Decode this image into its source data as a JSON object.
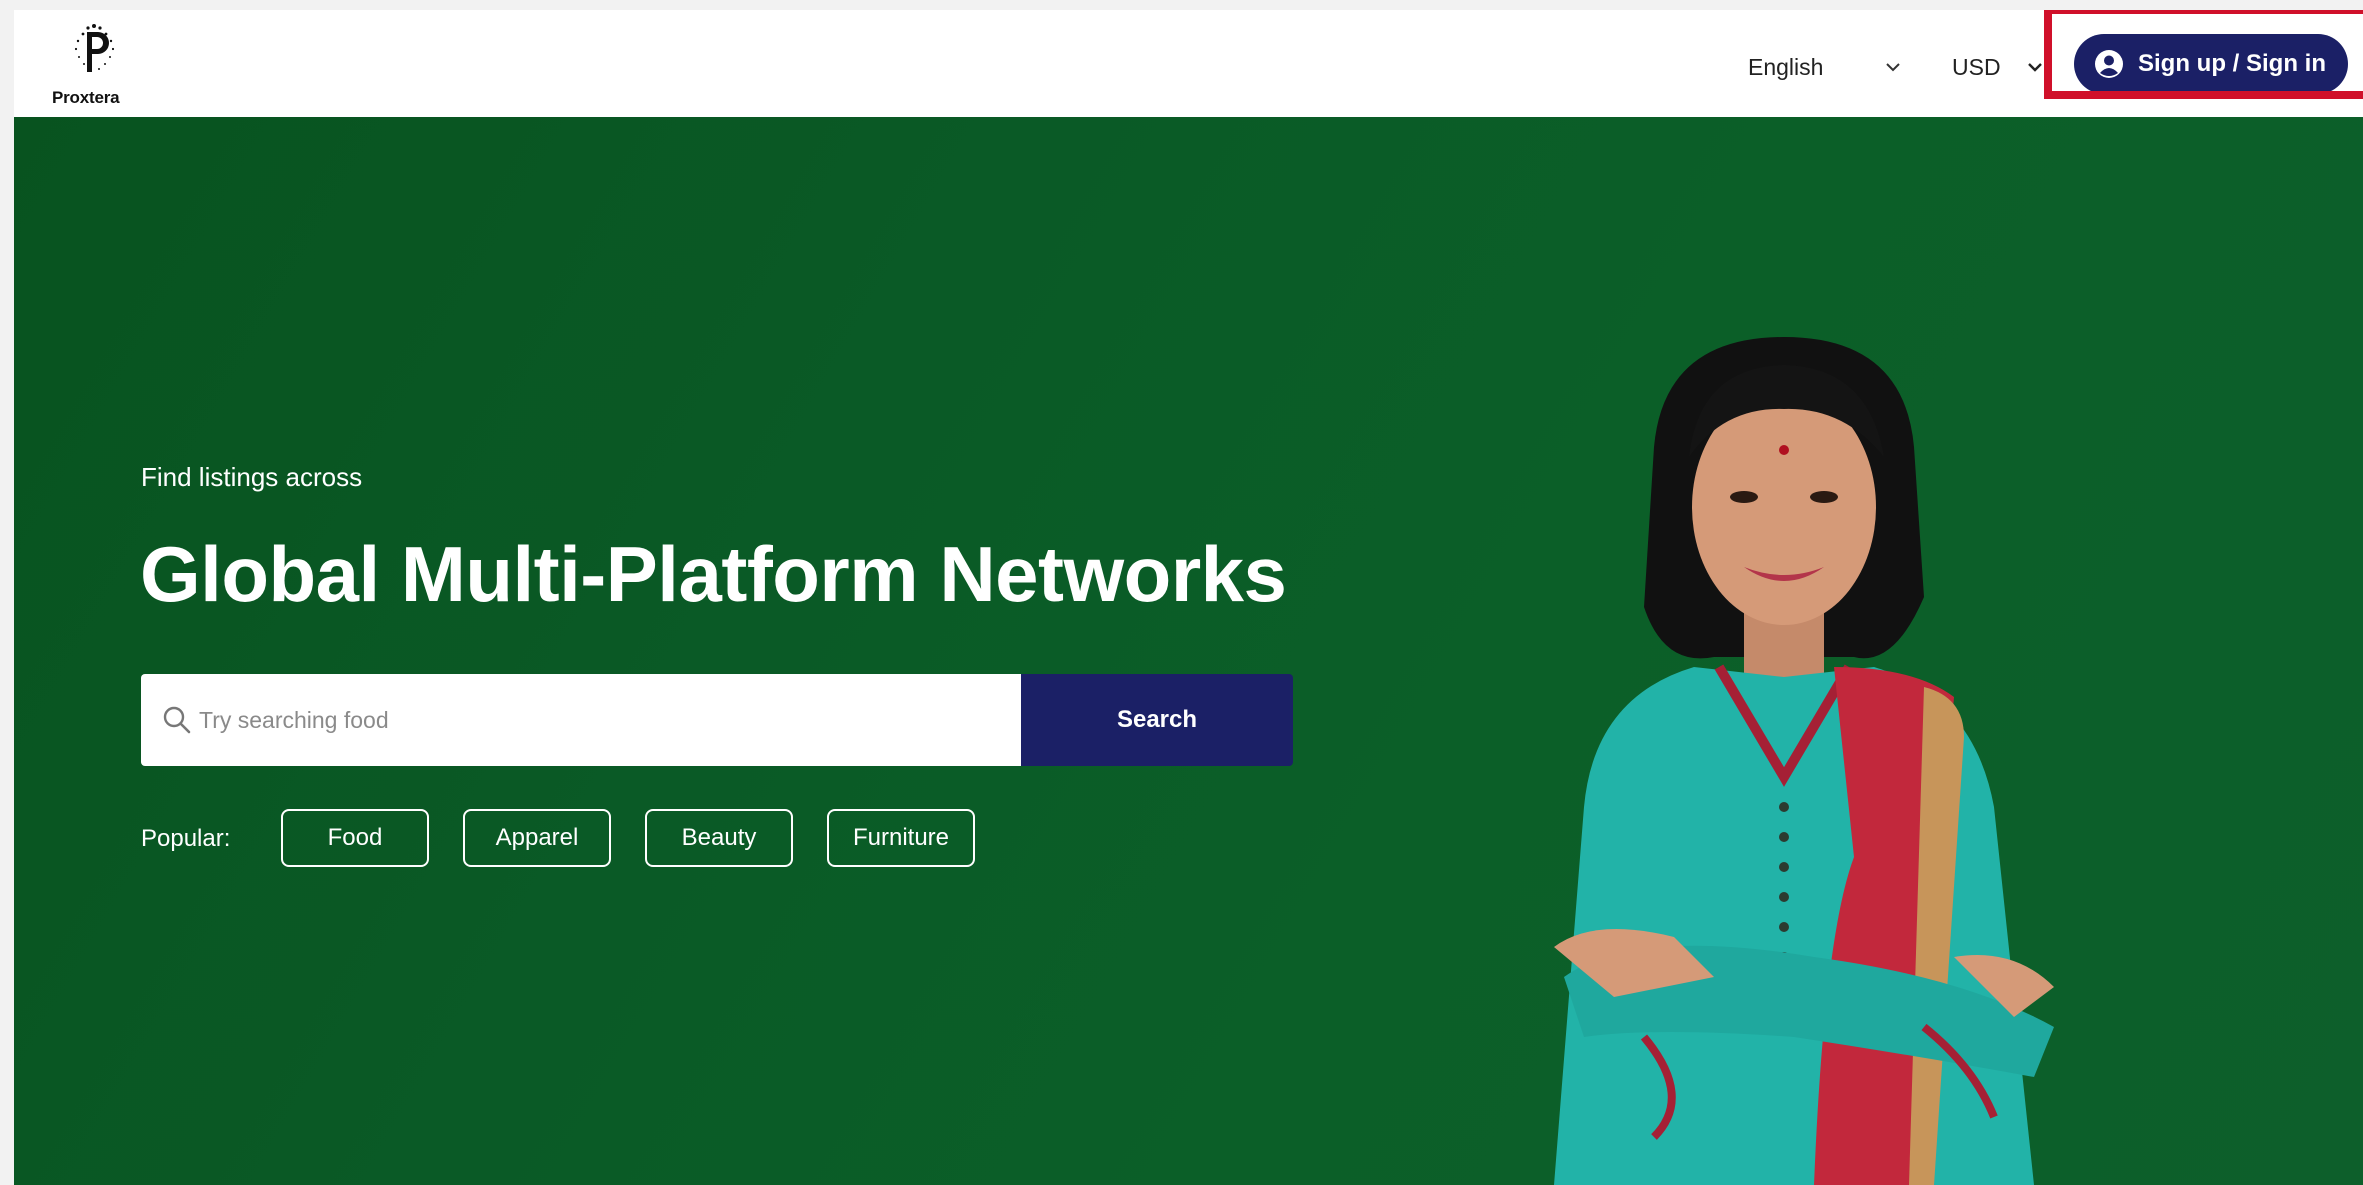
{
  "header": {
    "logo_text": "Proxtera",
    "language": "English",
    "currency": "USD",
    "signin_label": "Sign up / Sign in"
  },
  "hero": {
    "subtitle": "Find listings across",
    "title": "Global Multi-Platform Networks"
  },
  "search": {
    "placeholder": "Try searching food",
    "value": "",
    "button_label": "Search"
  },
  "popular": {
    "label": "Popular:",
    "chips": [
      "Food",
      "Apparel",
      "Beauty",
      "Furniture"
    ]
  },
  "colors": {
    "hero_green": "#0a5a26",
    "navy": "#1b2066",
    "highlight_red": "#d0102a"
  },
  "icons": {
    "language_chevron": "chevron-down-icon",
    "currency_chevron": "chevron-down-icon",
    "signin": "user-circle-icon",
    "search": "search-icon"
  }
}
